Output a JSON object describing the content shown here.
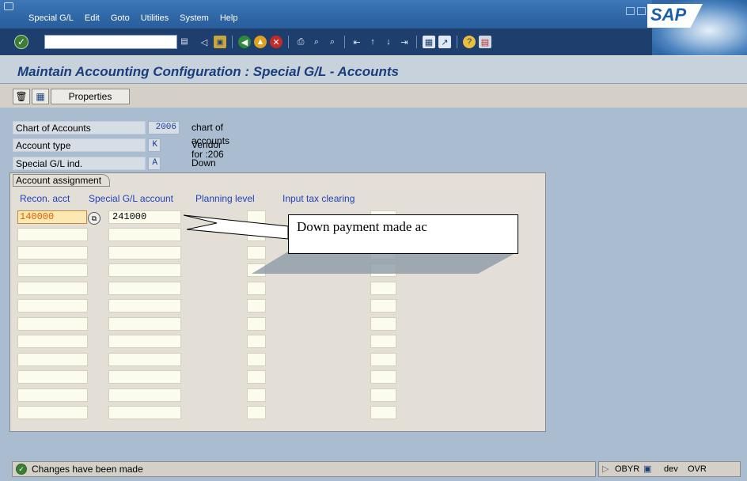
{
  "menubar": {
    "items": [
      "Special G/L",
      "Edit",
      "Goto",
      "Utilities",
      "System",
      "Help"
    ],
    "logo_text": "SAP"
  },
  "toolbar": {
    "command_value": "",
    "icons": [
      "enter-icon",
      "back-icon",
      "save-icon",
      "back-nav-icon",
      "exit-icon",
      "cancel-icon",
      "print-icon",
      "find-icon",
      "find-next-icon",
      "first-page-icon",
      "previous-page-icon",
      "next-page-icon",
      "last-page-icon",
      "create-session-icon",
      "shortcut-icon",
      "help-icon",
      "customize-layout-icon"
    ]
  },
  "page": {
    "title": "Maintain Accounting Configuration : Special G/L - Accounts"
  },
  "app_toolbar": {
    "properties_label": "Properties"
  },
  "header_fields": [
    {
      "label": "Chart of Accounts",
      "value": "2006",
      "desc": "chart of accounts for :206"
    },
    {
      "label": "Account type",
      "value": "K",
      "desc": "Vendor"
    },
    {
      "label": "Special G/L ind.",
      "value": "A",
      "desc": "Down payment on current assets"
    }
  ],
  "assignment": {
    "group_title": "Account assignment",
    "columns": [
      "Recon. acct",
      "Special G/L account",
      "Planning level",
      "Input tax clearing"
    ],
    "rows": [
      {
        "recon": "140000",
        "special": "241000",
        "planning": "",
        "input_tax": ""
      }
    ]
  },
  "callout": {
    "text": "Down payment made ac"
  },
  "status": {
    "message": "Changes have been made",
    "tcode": "OBYR",
    "system": "dev",
    "mode": "OVR"
  },
  "colors": {
    "menubar": "#2f66a6",
    "toolbar": "#1e3f6e",
    "title_text": "#1a3d7c",
    "main_bg": "#aabdd0",
    "column_header": "#2040c0"
  }
}
